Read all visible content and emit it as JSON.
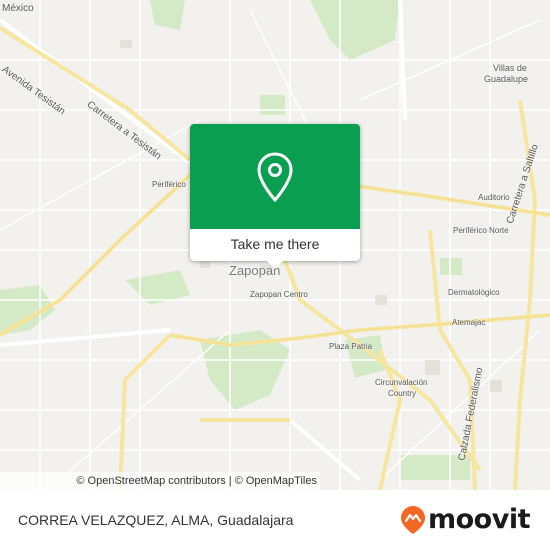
{
  "map": {
    "city": "Zapopan",
    "road_labels": {
      "tesistan": "Carretera a Tesistán",
      "avenida_tesistan": "Avenida Tesistán",
      "saltillo": "Carretera a Saltillo",
      "federalismo": "Calzada Federalismo",
      "mexico": "México"
    },
    "places": {
      "villas_1": "Villas de",
      "villas_2": "Guadalupe",
      "periferico": "Periférico",
      "auditorio": "Auditorio",
      "periferico_norte": "Periférico Norte",
      "zapopan_centro": "Zapopan Centro",
      "dermatologico": "Dermatológico",
      "atemajac": "Atemajac",
      "plaza_patria": "Plaza Patria",
      "circunvalacion_1": "Circunvalación",
      "circunvalacion_2": "Country"
    },
    "colors": {
      "land": "#f2f1ee",
      "park": "#cfe8c0",
      "arterial": "#fbeeb0",
      "accent": "#0a9e50"
    }
  },
  "popup": {
    "button_label": "Take me there",
    "pin_icon": "location-pin-icon"
  },
  "attribution": {
    "text": "© OpenStreetMap contributors | © OpenMapTiles"
  },
  "footer": {
    "stop_title": "CORREA VELAZQUEZ, ALMA, Guadalajara",
    "brand": "moovit",
    "brand_color": "#f26722"
  }
}
